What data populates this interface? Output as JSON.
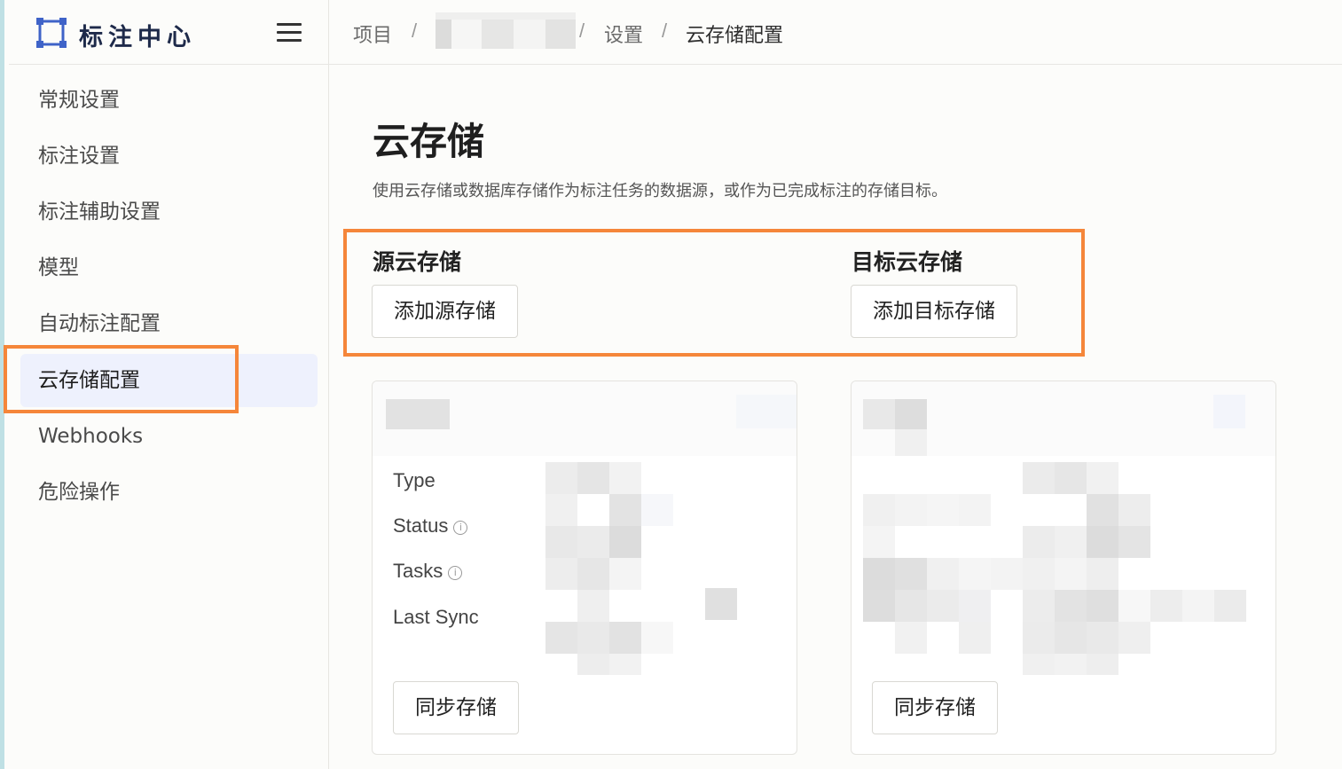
{
  "brand": {
    "title": "标注中心",
    "logo_icon": "bounding-box-icon",
    "accent": "#3f63c8"
  },
  "header": {
    "breadcrumbs": [
      {
        "label": "项目"
      },
      {
        "label": ""
      },
      {
        "label": "设置"
      },
      {
        "label": "云存储配置"
      }
    ]
  },
  "sidebar": {
    "items": [
      {
        "label": "常规设置",
        "active": false
      },
      {
        "label": "标注设置",
        "active": false
      },
      {
        "label": "标注辅助设置",
        "active": false
      },
      {
        "label": "模型",
        "active": false
      },
      {
        "label": "自动标注配置",
        "active": false
      },
      {
        "label": "云存储配置",
        "active": true
      },
      {
        "label": "Webhooks",
        "active": false
      },
      {
        "label": "危险操作",
        "active": false
      }
    ]
  },
  "main": {
    "title": "云存储",
    "description": "使用云存储或数据库存储作为标注任务的数据源，或作为已完成标注的存储目标。",
    "source": {
      "title": "源云存储",
      "add_button": "添加源存储"
    },
    "target": {
      "title": "目标云存储",
      "add_button": "添加目标存储"
    },
    "source_card": {
      "fields": [
        "Type",
        "Status",
        "Tasks",
        "Last Sync"
      ],
      "sync_button": "同步存储"
    },
    "target_card": {
      "sync_button": "同步存储"
    }
  },
  "colors": {
    "highlight": "#f5863a",
    "active_nav": "#eef1fd"
  }
}
